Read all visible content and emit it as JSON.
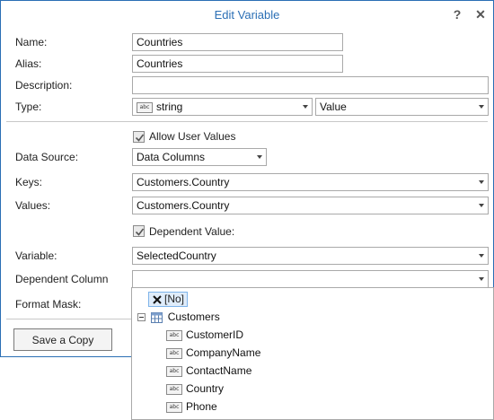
{
  "dialog": {
    "title": "Edit Variable",
    "help_label": "?",
    "close_label": "✕"
  },
  "labels": {
    "name": "Name:",
    "alias": "Alias:",
    "description": "Description:",
    "type": "Type:",
    "data_source": "Data Source:",
    "keys": "Keys:",
    "values": "Values:",
    "variable": "Variable:",
    "dependent_column": "Dependent Column",
    "format_mask": "Format Mask:"
  },
  "fields": {
    "name": "Countries",
    "alias": "Countries",
    "description": "",
    "type": "string",
    "type_mode": "Value",
    "data_source": "Data Columns",
    "keys": "Customers.Country",
    "values": "Customers.Country",
    "variable": "SelectedCountry",
    "dependent_column": ""
  },
  "checkboxes": {
    "allow_user_values": {
      "label": "Allow User Values",
      "checked": true
    },
    "dependent_value": {
      "label": "Dependent Value:",
      "checked": true
    }
  },
  "buttons": {
    "save_copy": "Save a Copy"
  },
  "dropdown": {
    "none_item": "[No]",
    "table": "Customers",
    "columns": [
      "CustomerID",
      "CompanyName",
      "ContactName",
      "Country",
      "Phone"
    ]
  },
  "icons": {
    "type_icon": "abc",
    "column_icon": "abc"
  }
}
